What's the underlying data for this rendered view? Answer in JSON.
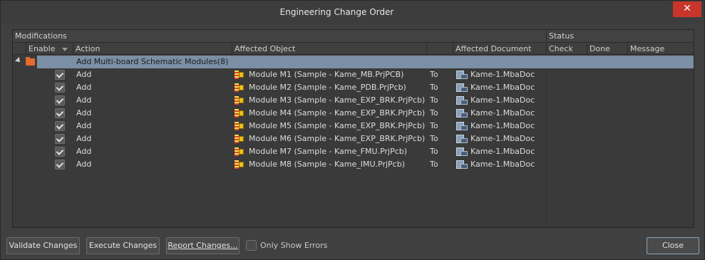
{
  "window": {
    "title": "Engineering Change Order",
    "close_glyph": "✕"
  },
  "grid": {
    "group_headers": {
      "modifications": "Modifications",
      "status": "Status"
    },
    "columns": {
      "enable": "Enable",
      "action": "Action",
      "affected_object": "Affected Object",
      "affected_document": "Affected Document",
      "check": "Check",
      "done": "Done",
      "message": "Message"
    },
    "group": {
      "label": "Add Multi-board Schematic Modules(8)",
      "icon": "folder-icon",
      "expanded": true
    },
    "rows": [
      {
        "enabled": true,
        "action": "Add",
        "object": "Module M1 (Sample - Kame_MB.PrjPCB)",
        "to": "To",
        "document": "Kame-1.MbaDoc"
      },
      {
        "enabled": true,
        "action": "Add",
        "object": "Module M2 (Sample - Kame_PDB.PrjPcb)",
        "to": "To",
        "document": "Kame-1.MbaDoc"
      },
      {
        "enabled": true,
        "action": "Add",
        "object": "Module M3 (Sample - Kame_EXP_BRK.PrjPcb)",
        "to": "To",
        "document": "Kame-1.MbaDoc"
      },
      {
        "enabled": true,
        "action": "Add",
        "object": "Module M4 (Sample - Kame_EXP_BRK.PrjPcb)",
        "to": "To",
        "document": "Kame-1.MbaDoc"
      },
      {
        "enabled": true,
        "action": "Add",
        "object": "Module M5 (Sample - Kame_EXP_BRK.PrjPcb)",
        "to": "To",
        "document": "Kame-1.MbaDoc"
      },
      {
        "enabled": true,
        "action": "Add",
        "object": "Module M6 (Sample - Kame_EXP_BRK.PrjPcb)",
        "to": "To",
        "document": "Kame-1.MbaDoc"
      },
      {
        "enabled": true,
        "action": "Add",
        "object": "Module M7 (Sample - Kame_FMU.PrjPcb)",
        "to": "To",
        "document": "Kame-1.MbaDoc"
      },
      {
        "enabled": true,
        "action": "Add",
        "object": "Module M8 (Sample - Kame_IMU.PrjPcb)",
        "to": "To",
        "document": "Kame-1.MbaDoc"
      }
    ]
  },
  "footer": {
    "validate_label": "Validate Changes",
    "execute_label": "Execute Changes",
    "report_label": "Report Changes...",
    "only_errors_label": "Only Show Errors",
    "only_errors_checked": false,
    "close_label": "Close"
  },
  "colors": {
    "selection": "#7b8fa5",
    "close_button": "#c8352a",
    "folder": "#e46a2e"
  }
}
